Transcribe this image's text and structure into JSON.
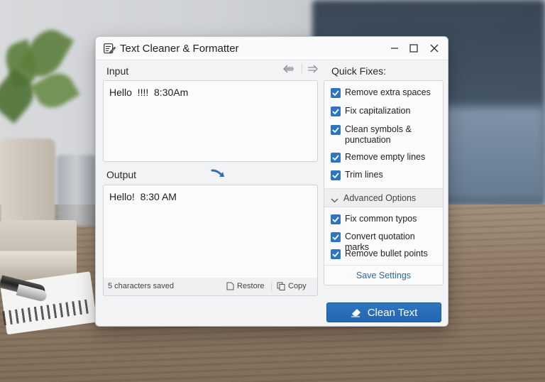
{
  "window": {
    "title": "Text Cleaner & Formatter"
  },
  "input": {
    "label": "Input",
    "value": "Hello  !!!!  8:30Am"
  },
  "output": {
    "label": "Output",
    "value": "Hello!  8:30 AM",
    "status": "5 characters saved",
    "restore_label": "Restore",
    "copy_label": "Copy"
  },
  "quick_fixes": {
    "label": "Quick Fixes:",
    "items": [
      {
        "label": "Remove extra spaces",
        "checked": true
      },
      {
        "label": "Fix capitalization",
        "checked": true
      },
      {
        "label": "Clean symbols & punctuation",
        "checked": true
      },
      {
        "label": "Remove empty lines",
        "checked": true
      },
      {
        "label": "Trim lines",
        "checked": true
      }
    ]
  },
  "advanced": {
    "label": "Advanced Options",
    "items": [
      {
        "label": "Fix common typos",
        "checked": true
      },
      {
        "label": "Convert quotation marks",
        "checked": true
      },
      {
        "label": "Remove bullet points",
        "checked": true
      }
    ]
  },
  "save_settings_label": "Save Settings",
  "clean_button_label": "Clean Text",
  "colors": {
    "accent": "#2f74c0",
    "link": "#2a67ad"
  }
}
